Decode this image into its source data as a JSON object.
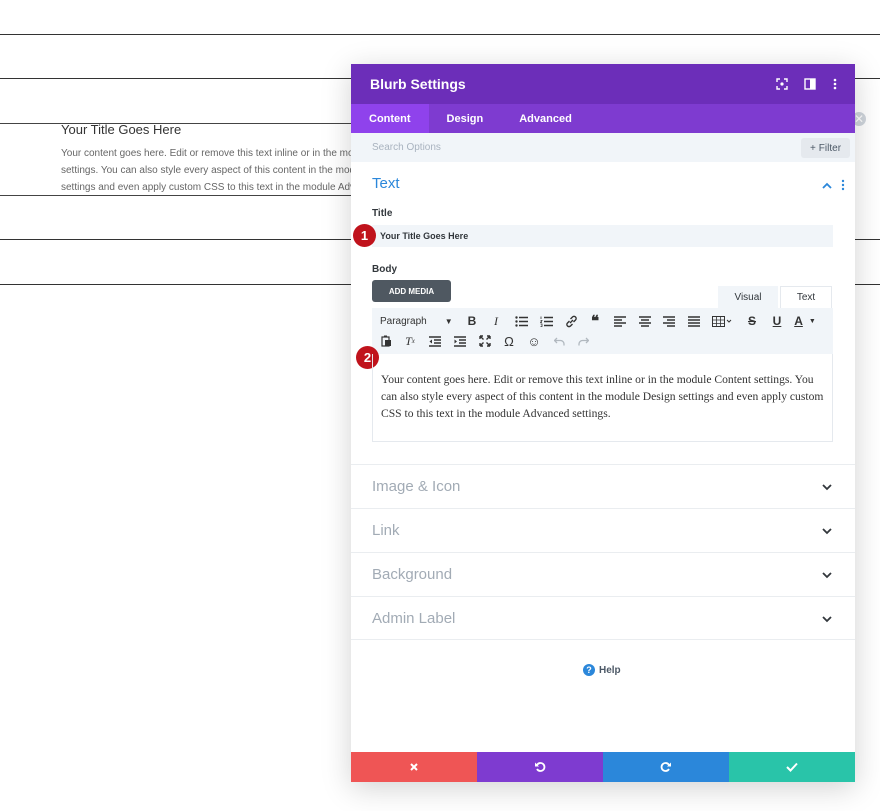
{
  "colors": {
    "header": "#6c2eb9",
    "tabs_bg": "#7e3bd0",
    "tab_active": "#8f42ec",
    "accent": "#2b87da",
    "badge": "#c0131c",
    "cancel": "#ef5555",
    "undo": "#7e3bd0",
    "redo": "#2b87da",
    "save": "#29c4a9"
  },
  "background_module": {
    "title": "Your Title Goes Here",
    "body_lines": [
      "Your content goes here. Edit or remove this text inline or in the module Content",
      "settings. You can also style every aspect of this content in the module Design settings",
      "settings and even apply custom CSS to this text in the module Advanced settings."
    ]
  },
  "modal": {
    "title": "Blurb Settings",
    "header_icons": [
      "focus-icon",
      "split-view-icon",
      "more-icon"
    ],
    "tabs": [
      {
        "label": "Content",
        "active": true
      },
      {
        "label": "Design",
        "active": false
      },
      {
        "label": "Advanced",
        "active": false
      }
    ],
    "search": {
      "placeholder": "Search Options",
      "filter_label": "Filter"
    },
    "text_section": {
      "title": "Text",
      "title_field_label": "Title",
      "title_value": "Your Title Goes Here",
      "body_field_label": "Body",
      "add_media_label": "ADD MEDIA",
      "editor_tabs": [
        "Visual",
        "Text"
      ],
      "paragraph_select": "Paragraph",
      "body_text": "Your content goes here. Edit or remove this text inline or in the module Content settings. You can also style every aspect of this content in the module Design settings and even apply custom CSS to this text in the module Advanced settings."
    },
    "badges": [
      "1",
      "2"
    ],
    "accordions": [
      "Image & Icon",
      "Link",
      "Background",
      "Admin Label"
    ],
    "help_label": "Help",
    "footer_buttons": [
      "cancel",
      "undo",
      "redo",
      "save"
    ]
  }
}
